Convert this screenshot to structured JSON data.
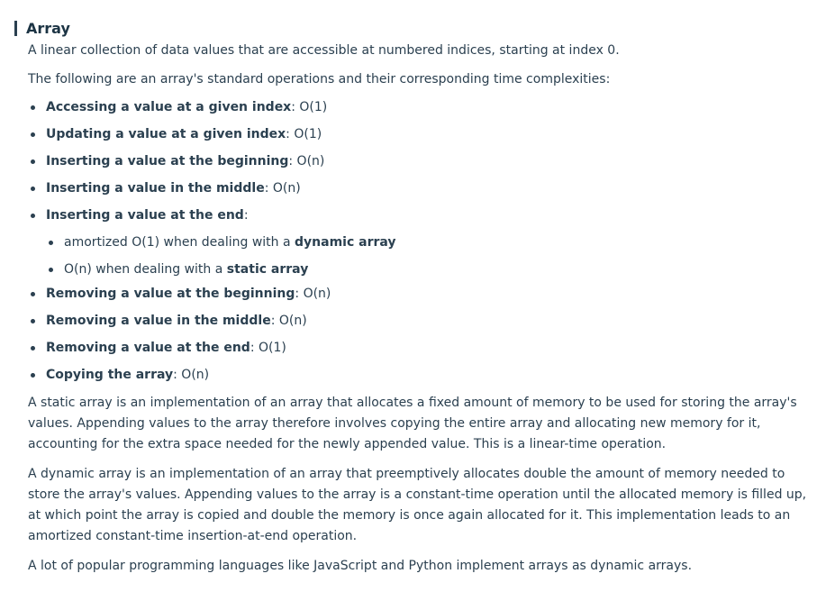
{
  "title": "Array",
  "definition": "A linear collection of data values that are accessible at numbered indices, starting at index 0.",
  "intro": "The following are an array's standard operations and their corresponding time complexities:",
  "operations": [
    {
      "name": "Accessing a value at a given index",
      "complexity": ": O(1)"
    },
    {
      "name": "Updating a value at a given index",
      "complexity": ": O(1)"
    },
    {
      "name": "Inserting a value at the beginning",
      "complexity": ": O(n)"
    },
    {
      "name": "Inserting a value in the middle",
      "complexity": ": O(n)"
    },
    {
      "name": "Inserting a value at the end",
      "complexity": ":"
    },
    {
      "name": "Removing a value at the beginning",
      "complexity": ": O(n)"
    },
    {
      "name": "Removing a value in the middle",
      "complexity": ": O(n)"
    },
    {
      "name": "Removing a value at the end",
      "complexity": ": O(1)"
    },
    {
      "name": "Copying the array",
      "complexity": ": O(n)"
    }
  ],
  "insert_end_sub": [
    {
      "prefix": "amortized O(1) when dealing with a ",
      "term": "dynamic array"
    },
    {
      "prefix": "O(n) when dealing with a ",
      "term": "static array"
    }
  ],
  "paragraphs": {
    "static": "A static array is an implementation of an array that allocates a fixed amount of memory to be used for storing the array's values. Appending values to the array therefore involves copying the entire array and allocating new memory for it, accounting for the extra space needed for the newly appended value. This is a linear-time operation.",
    "dynamic": "A dynamic array is an implementation of an array that preemptively allocates double the amount of memory needed to store the array's values. Appending values to the array is a constant-time operation until the allocated memory is filled up, at which point the array is copied and double the memory is once again allocated for it. This implementation leads to an amortized constant-time insertion-at-end operation.",
    "popular": "A lot of popular programming languages like JavaScript and Python implement arrays as dynamic arrays."
  }
}
